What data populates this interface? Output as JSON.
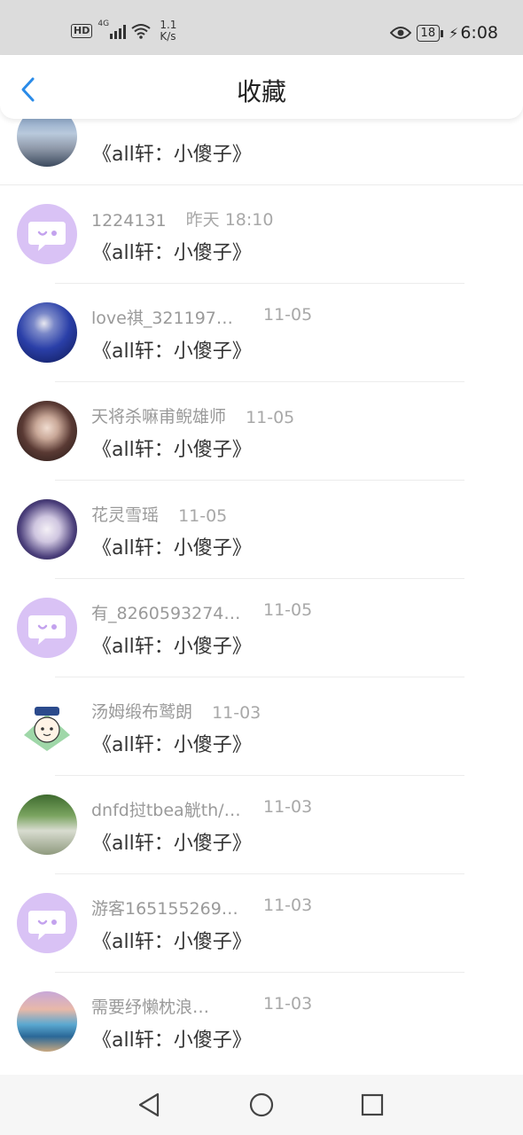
{
  "status_bar": {
    "hd": "HD",
    "network": "4G",
    "speed_value": "1.1",
    "speed_unit": "K/s",
    "battery": "18",
    "time": "6:08"
  },
  "header": {
    "title": "收藏"
  },
  "items": [
    {
      "name": "",
      "time": "",
      "title": "《all轩：小傻子》"
    },
    {
      "name": "1224131",
      "time": "昨天 18:10",
      "title": "《all轩：小傻子》"
    },
    {
      "name": "love祺_3211970…",
      "time": "11-05",
      "title": "《all轩：小傻子》"
    },
    {
      "name": "天将杀嘛甫鲵雄师",
      "time": "11-05",
      "title": "《all轩：小傻子》"
    },
    {
      "name": "花灵雪瑶",
      "time": "11-05",
      "title": "《all轩：小傻子》"
    },
    {
      "name": "有_8260593274…",
      "time": "11-05",
      "title": "《all轩：小傻子》"
    },
    {
      "name": "汤姆缎布鹫朗",
      "time": "11-03",
      "title": "《all轩：小傻子》"
    },
    {
      "name": "dnfd挝tbea觥th/…",
      "time": "11-03",
      "title": "《all轩：小傻子》"
    },
    {
      "name": "游客165155269…",
      "time": "11-03",
      "title": "《all轩：小傻子》"
    },
    {
      "name": "需要纾懒枕浪…",
      "time": "11-03",
      "title": "《all轩：小傻子》"
    }
  ]
}
